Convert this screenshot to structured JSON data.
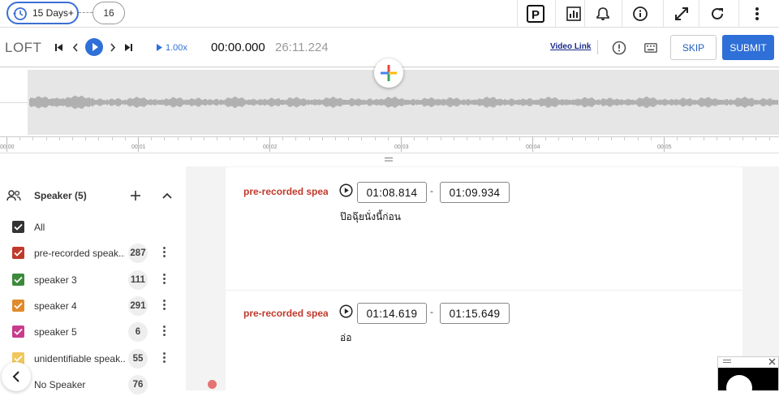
{
  "top": {
    "days_pill": "15 Days+",
    "step_count": "16"
  },
  "controls": {
    "brand": "LOFT",
    "speed": "1.00x",
    "current_time": "00:00.000",
    "duration": "26:11.224",
    "video_link": "Video Link",
    "skip": "SKIP",
    "submit": "SUBMIT"
  },
  "ruler": {
    "ticks": [
      "00:00",
      "00:01",
      "00:02",
      "00:03",
      "00:04",
      "00:05"
    ]
  },
  "sidebar": {
    "title": "Speaker (5)",
    "items": [
      {
        "label": "All",
        "count": "",
        "color": "#333333"
      },
      {
        "label": "pre-recorded speak...",
        "count": "287",
        "color": "#c0392b"
      },
      {
        "label": "speaker 3",
        "count": "111",
        "color": "#3c8a3c"
      },
      {
        "label": "speaker 4",
        "count": "291",
        "color": "#e08a2c"
      },
      {
        "label": "speaker 5",
        "count": "6",
        "color": "#c83c8c"
      },
      {
        "label": "unidentifiable speak...",
        "count": "55",
        "color": "#f1c75b"
      },
      {
        "label": "No Speaker",
        "count": "76",
        "color": ""
      }
    ]
  },
  "segments": [
    {
      "speaker": "pre-recorded speake",
      "start": "01:08.814",
      "end": "01:09.934",
      "text": "ป๊อฉุ๊ยนั่งนี้ก่อน"
    },
    {
      "speaker": "pre-recorded speake",
      "start": "01:14.619",
      "end": "01:15.649",
      "text": "อ่อ"
    }
  ],
  "colors": {
    "accent": "#2e6fd8",
    "speaker_pre": "#c0392b"
  }
}
